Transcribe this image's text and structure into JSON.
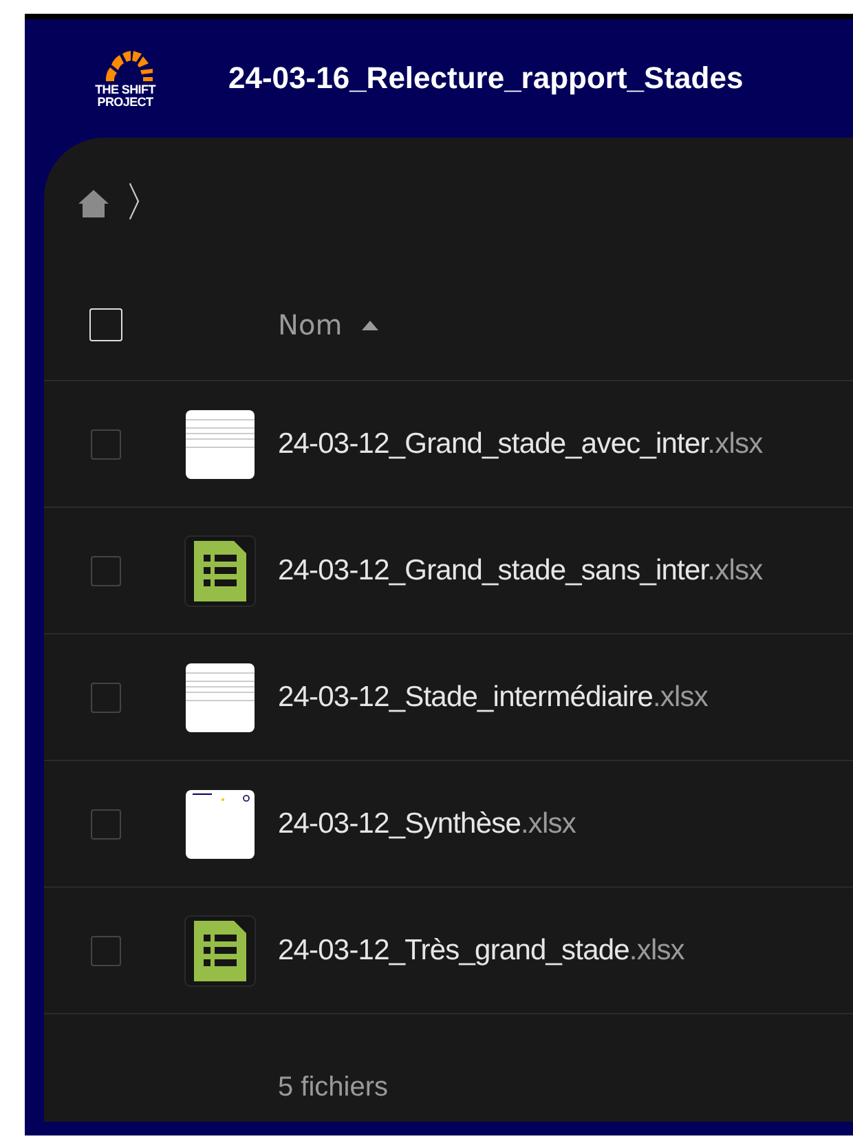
{
  "header": {
    "logo_lines": [
      "THE SHIFT",
      "PROJECT"
    ],
    "title": "24-03-16_Relecture_rapport_Stades"
  },
  "breadcrumb": {
    "separator": "〉"
  },
  "table": {
    "select_all_checked": false,
    "columns": [
      {
        "label": "Nom",
        "sorted_ascending": true
      }
    ],
    "rows": [
      {
        "file_name": "24-03-12_Grand_stade_avec_inter.xlsx",
        "kind": "preview",
        "checked": false
      },
      {
        "file_name": "24-03-12_Grand_stade_sans_inter.xlsx",
        "kind": "spreadsheet",
        "checked": false
      },
      {
        "file_name": "24-03-12_Stade_intermédiaire.xlsx",
        "kind": "preview",
        "checked": false
      },
      {
        "file_name": "24-03-12_Synthèse.xlsx",
        "kind": "summary",
        "checked": false
      },
      {
        "file_name": "24-03-12_Très_grand_stade.xlsx",
        "kind": "spreadsheet",
        "checked": false
      }
    ],
    "footer": "5 fichiers"
  }
}
